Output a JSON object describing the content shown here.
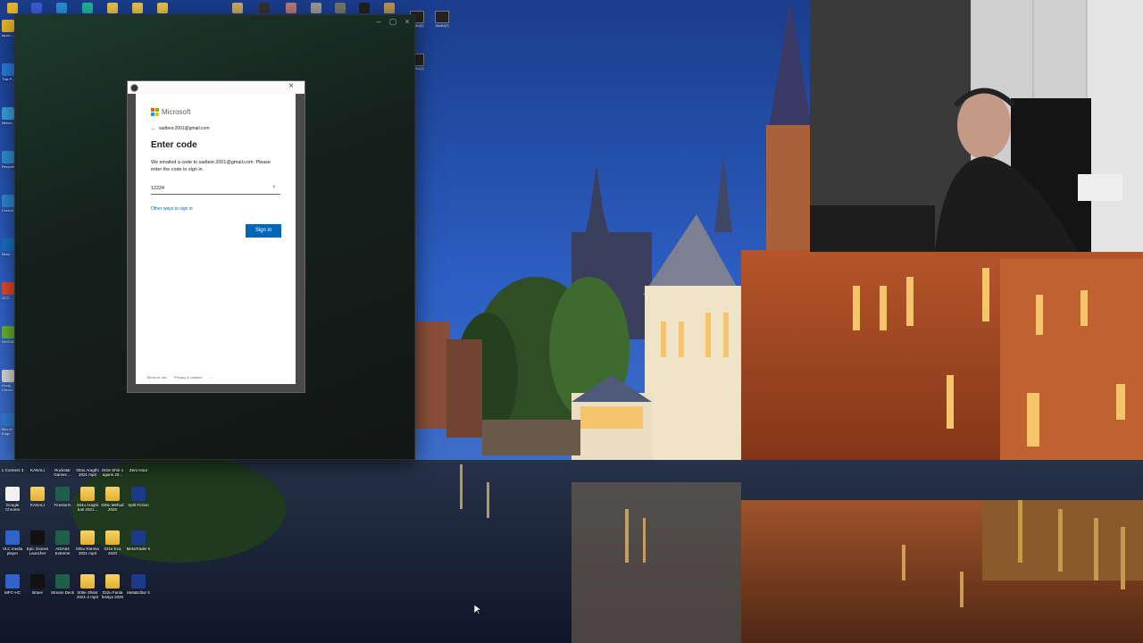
{
  "dialog": {
    "brand": "Microsoft",
    "back_account": "sadtesr.2001@gmail.com",
    "title": "Enter code",
    "description": "We emailed a code to sadtesr.2001@gmail.com. Please enter the code to sign in.",
    "code_value": "12224",
    "clear_icon": "×",
    "other_ways_link": "Other ways to sign in",
    "signin_button": "Sign in",
    "footer": {
      "terms": "Terms of use",
      "privacy": "Privacy & cookies",
      "more": "..."
    },
    "close_glyph": "×"
  },
  "app_window": {
    "controls": [
      "–",
      "▢",
      "×"
    ]
  },
  "desktop": {
    "row1": [
      {
        "label": "L-Connect 3",
        "kind": "app"
      },
      {
        "label": "KANALI",
        "kind": "folder"
      },
      {
        "label": "Rockstar Games ...",
        "kind": "app"
      },
      {
        "label": "003u Aragthi 2021 mp3",
        "kind": "folder"
      },
      {
        "label": "010e Shiri o agami 20...",
        "kind": "folder"
      },
      {
        "label": "Zero Hour",
        "kind": "app"
      }
    ],
    "row2": [
      {
        "label": "Google Chrome",
        "kind": "file"
      },
      {
        "label": "KANALI",
        "kind": "folder"
      },
      {
        "label": "Firestorm",
        "kind": "app"
      },
      {
        "label": "004u Araghi bati 2021...",
        "kind": "folder"
      },
      {
        "label": "030u Mehud 2020",
        "kind": "folder"
      },
      {
        "label": "Split Fiction",
        "kind": "app"
      }
    ],
    "row3": [
      {
        "label": "VLC media player",
        "kind": "app"
      },
      {
        "label": "Epic Games Launcher",
        "kind": "app"
      },
      {
        "label": "AIDA64 Extreme",
        "kind": "app"
      },
      {
        "label": "005u Rarmia 2021 mp3",
        "kind": "folder"
      },
      {
        "label": "021e Eca 2020",
        "kind": "folder"
      },
      {
        "label": "MetaTrader 5",
        "kind": "app"
      }
    ],
    "row4": [
      {
        "label": "MPC-HC",
        "kind": "app"
      },
      {
        "label": "Brave",
        "kind": "app"
      },
      {
        "label": "Stream Deck",
        "kind": "app"
      },
      {
        "label": "006e Shitet 2021-2 mp3",
        "kind": "folder"
      },
      {
        "label": "022u Fanta festiya 2020",
        "kind": "folder"
      },
      {
        "label": "MetaEditor 5",
        "kind": "app"
      }
    ],
    "left_column": [
      {
        "label": "mpco..."
      },
      {
        "label": "This P..."
      },
      {
        "label": "Netwo..."
      },
      {
        "label": "Recycle..."
      },
      {
        "label": "Control..."
      },
      {
        "label": "Bittla..."
      },
      {
        "label": "GCC..."
      },
      {
        "label": "NVIDIA..."
      },
      {
        "label": "Goog Chrom"
      },
      {
        "label": "Micros Edge"
      }
    ],
    "top_icons_labels": [
      "Audio(2)",
      "Audio(2)",
      "Audio(1)"
    ]
  },
  "colors": {
    "ms_red": "#f25022",
    "ms_green": "#7fba00",
    "ms_blue": "#00a4ef",
    "ms_yellow": "#ffb900",
    "accent": "#0067b8"
  }
}
